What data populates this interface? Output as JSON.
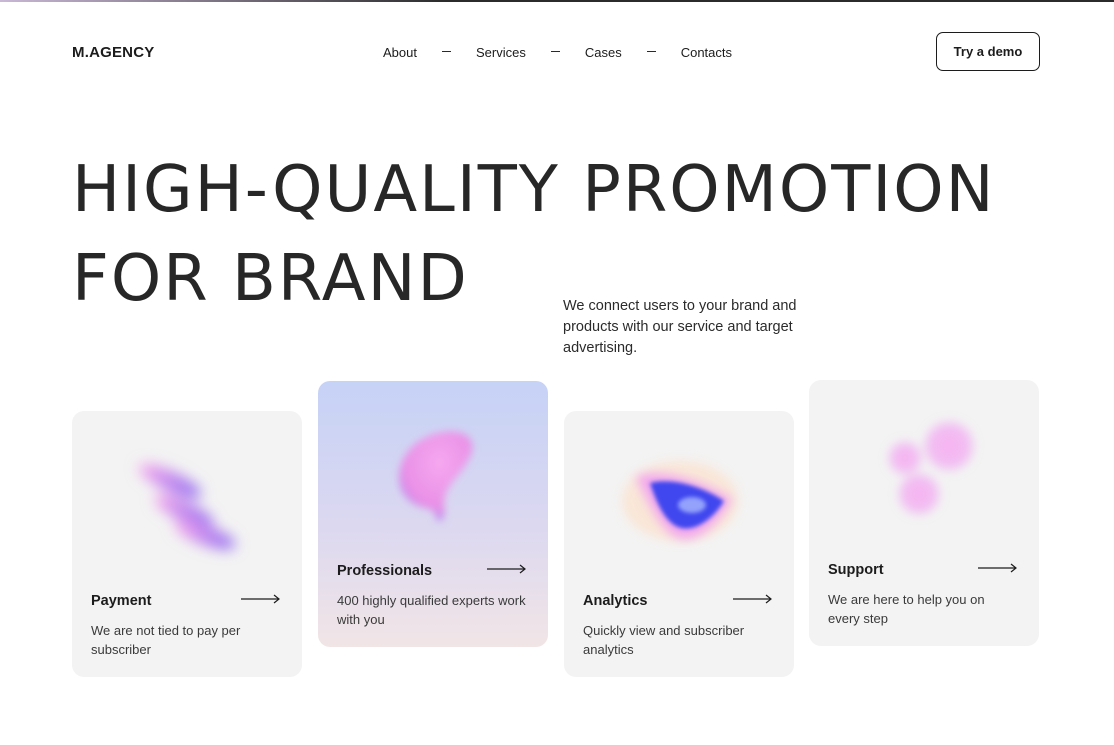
{
  "brand": {
    "logo": "M.AGENCY"
  },
  "nav": {
    "items": [
      {
        "label": "About"
      },
      {
        "label": "Services"
      },
      {
        "label": "Cases"
      },
      {
        "label": "Contacts"
      }
    ]
  },
  "header": {
    "cta_label": "Try a demo"
  },
  "hero": {
    "title_line1": "HIGH-QUALITY PROMOTION",
    "title_line2": "FOR BRAND",
    "lead": "We connect users to your brand and products with our service and target advertising."
  },
  "cards": [
    {
      "title": "Payment",
      "description": "We are not tied to pay per subscriber",
      "icon": "arrow-right-icon"
    },
    {
      "title": "Professionals",
      "description": "400 highly qualified experts work with you",
      "icon": "arrow-right-icon"
    },
    {
      "title": "Analytics",
      "description": "Quickly view and subscriber analytics",
      "icon": "arrow-right-icon"
    },
    {
      "title": "Support",
      "description": "We are here to help you on every step",
      "icon": "arrow-right-icon"
    }
  ],
  "colors": {
    "text": "#1c1c1c",
    "card_bg": "#f3f3f3",
    "accent_pink": "#f0a0e8",
    "accent_blue": "#3b4df5"
  }
}
